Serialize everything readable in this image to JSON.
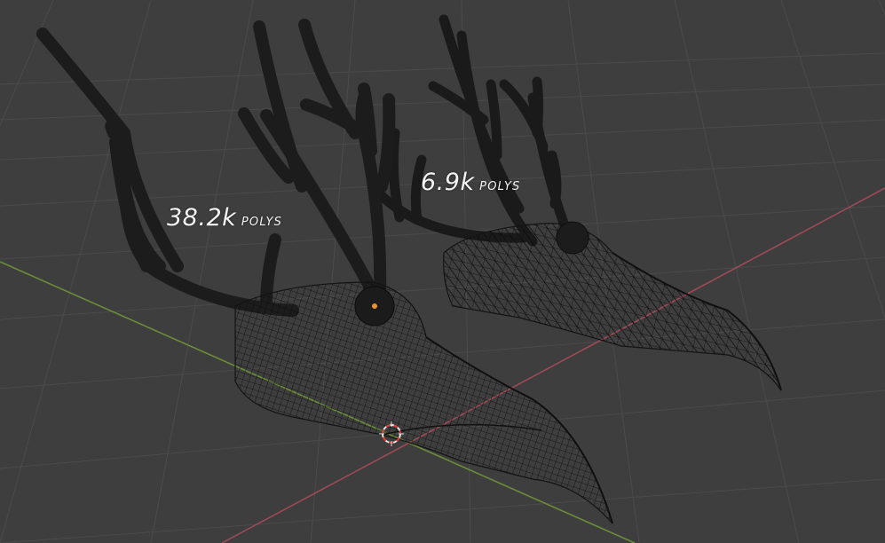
{
  "viewport": {
    "labels": [
      {
        "number": "38.2k",
        "unit": "polys"
      },
      {
        "number": "6.9k",
        "unit": "polys"
      }
    ],
    "colors": {
      "background": "#3e3e3e",
      "grid_line": "#4a4a4a",
      "x_axis": "#9a4a55",
      "y_axis": "#6a8a3a",
      "mesh_fill": "#1e1e1e",
      "wire": "#0d0d0d",
      "origin_dot": "#f0902a",
      "cursor_red": "#e0403a"
    },
    "icons": [
      "3d-cursor-icon",
      "object-origin-icon"
    ]
  }
}
